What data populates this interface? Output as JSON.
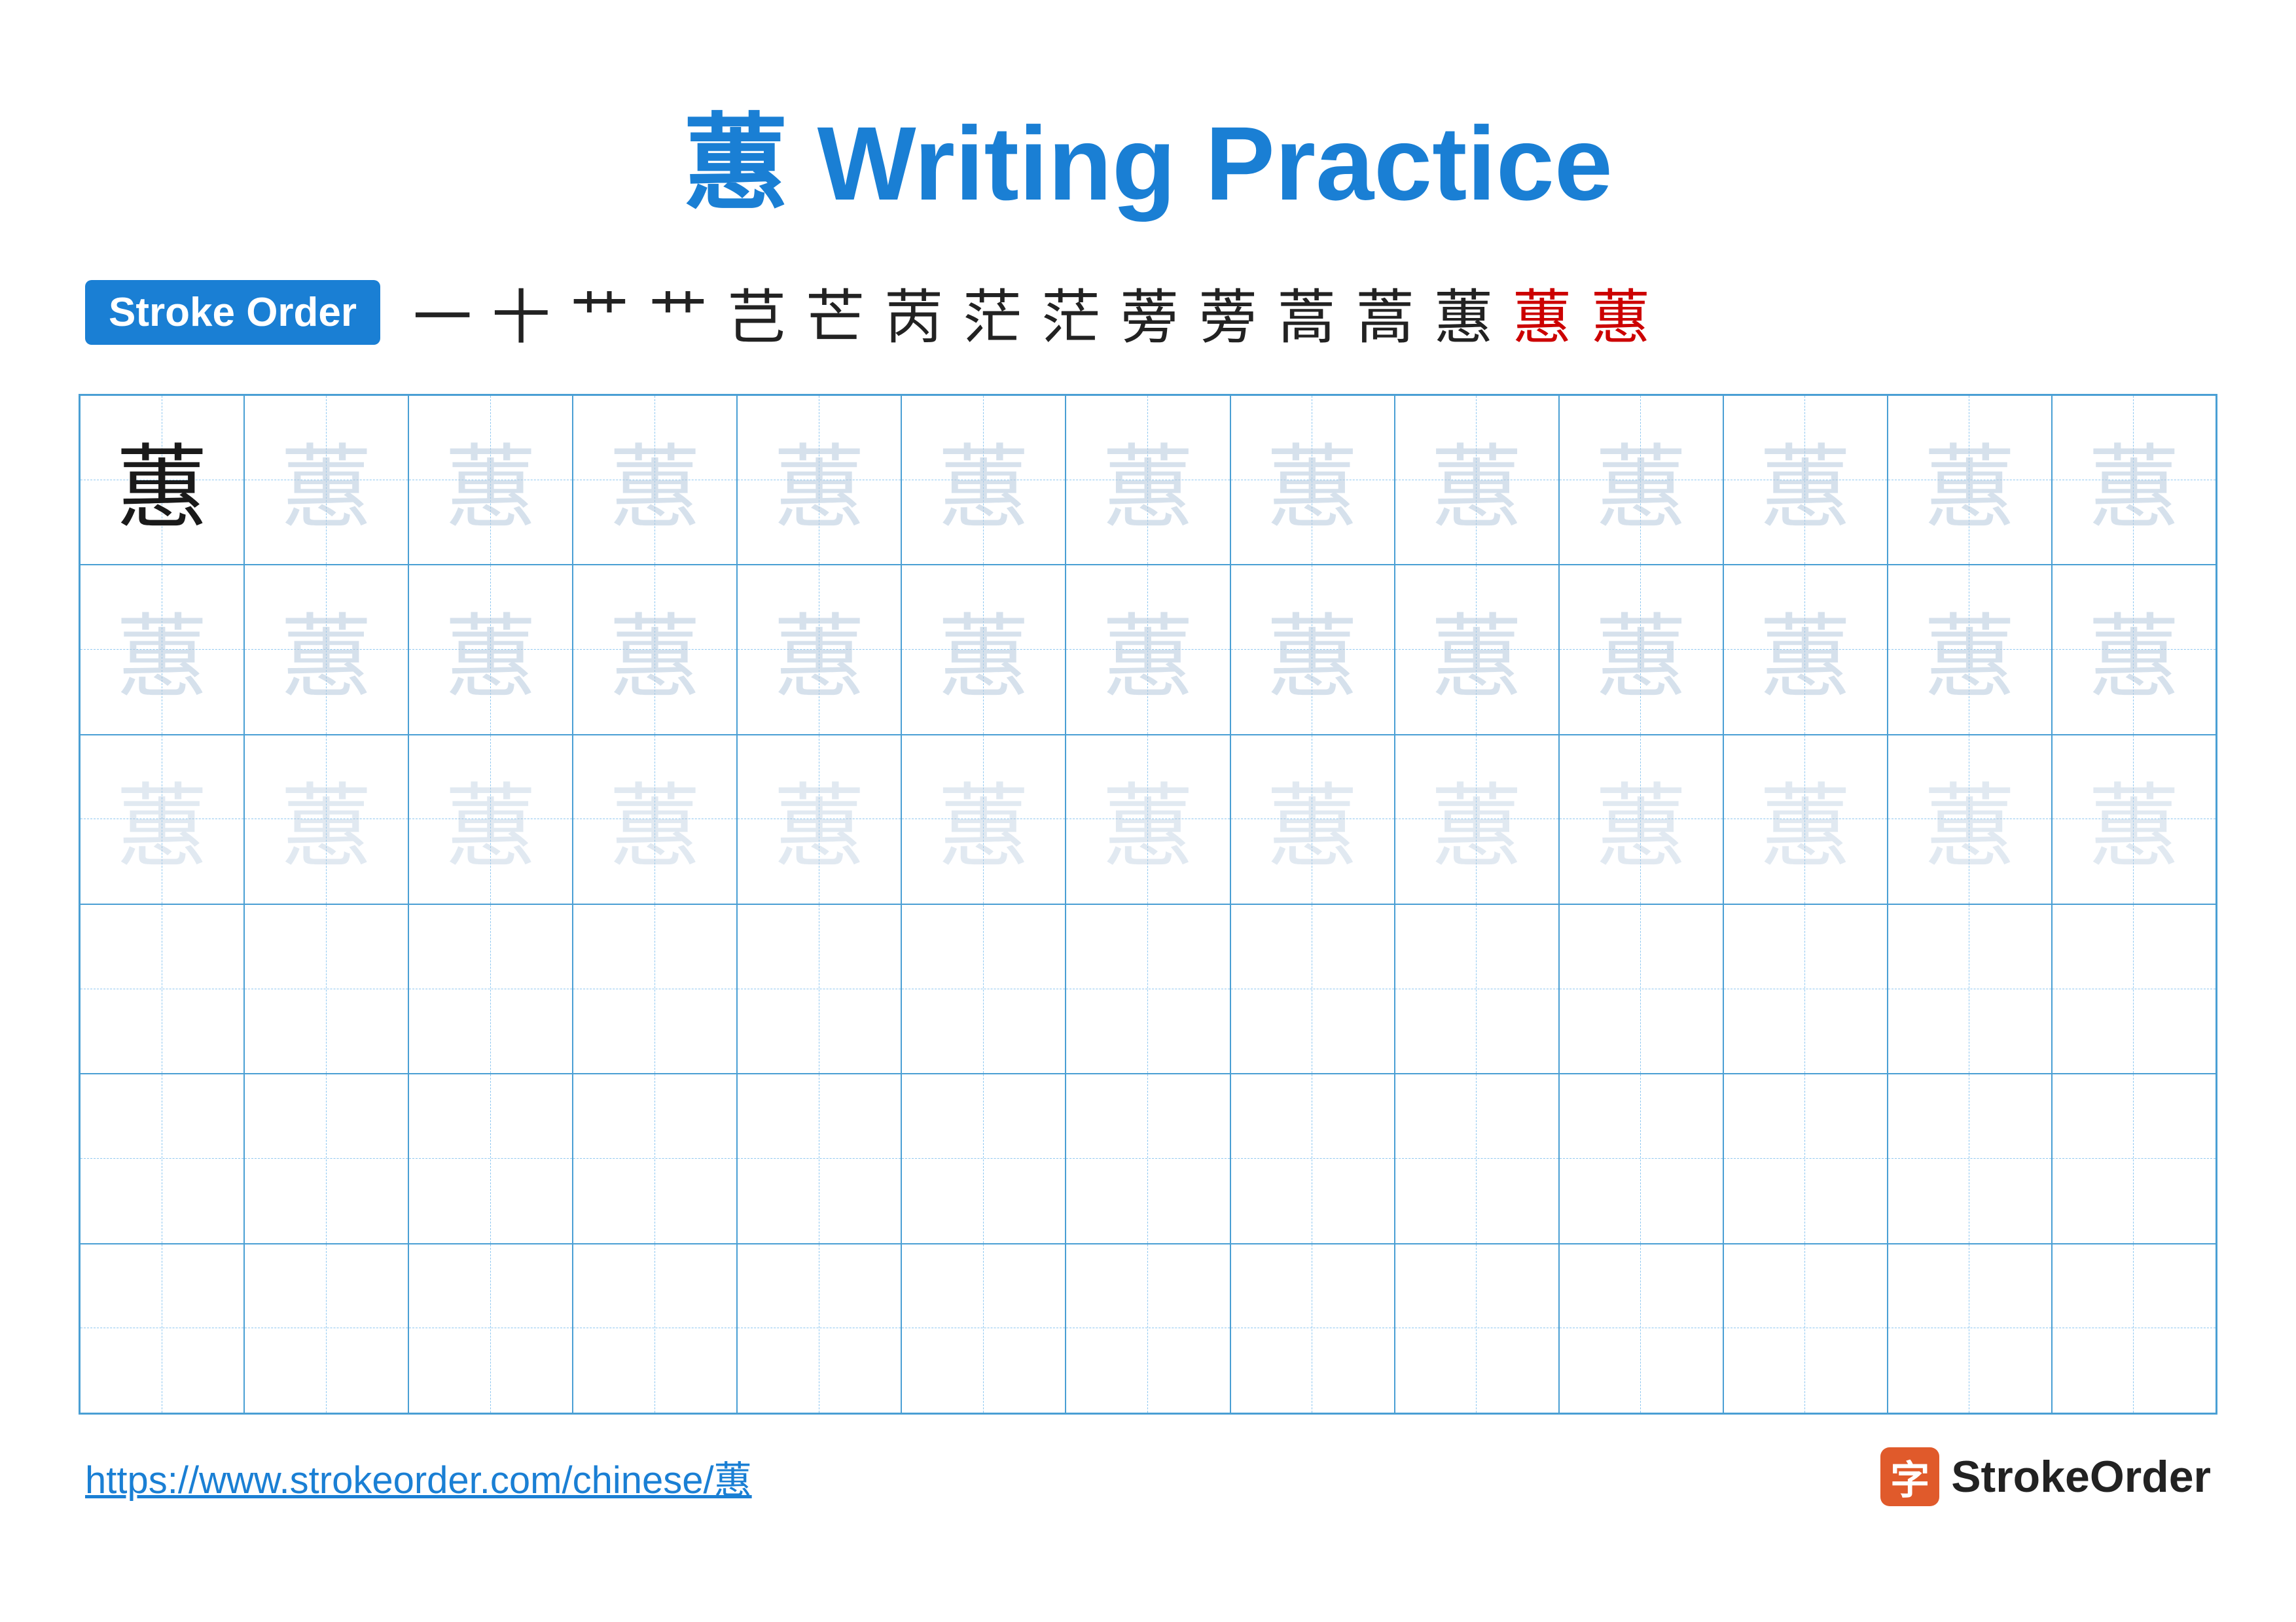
{
  "title": {
    "char": "蕙",
    "label": " Writing Practice",
    "full": "蕙 Writing Practice"
  },
  "stroke_order": {
    "badge_label": "Stroke Order",
    "strokes": [
      "一",
      "十",
      "艹",
      "艹",
      "芑",
      "芒",
      "苪",
      "茫",
      "茫",
      "蒡",
      "蒡",
      "蒿",
      "蒿",
      "蕙",
      "蕙",
      "蕙"
    ]
  },
  "grid": {
    "cols": 13,
    "rows": 6,
    "char": "蕙",
    "row_styles": [
      "dark",
      "light",
      "very-light",
      "empty",
      "empty",
      "empty"
    ]
  },
  "footer": {
    "url": "https://www.strokeorder.com/chinese/蕙",
    "logo_char": "字",
    "logo_label": "StrokeOrder"
  }
}
